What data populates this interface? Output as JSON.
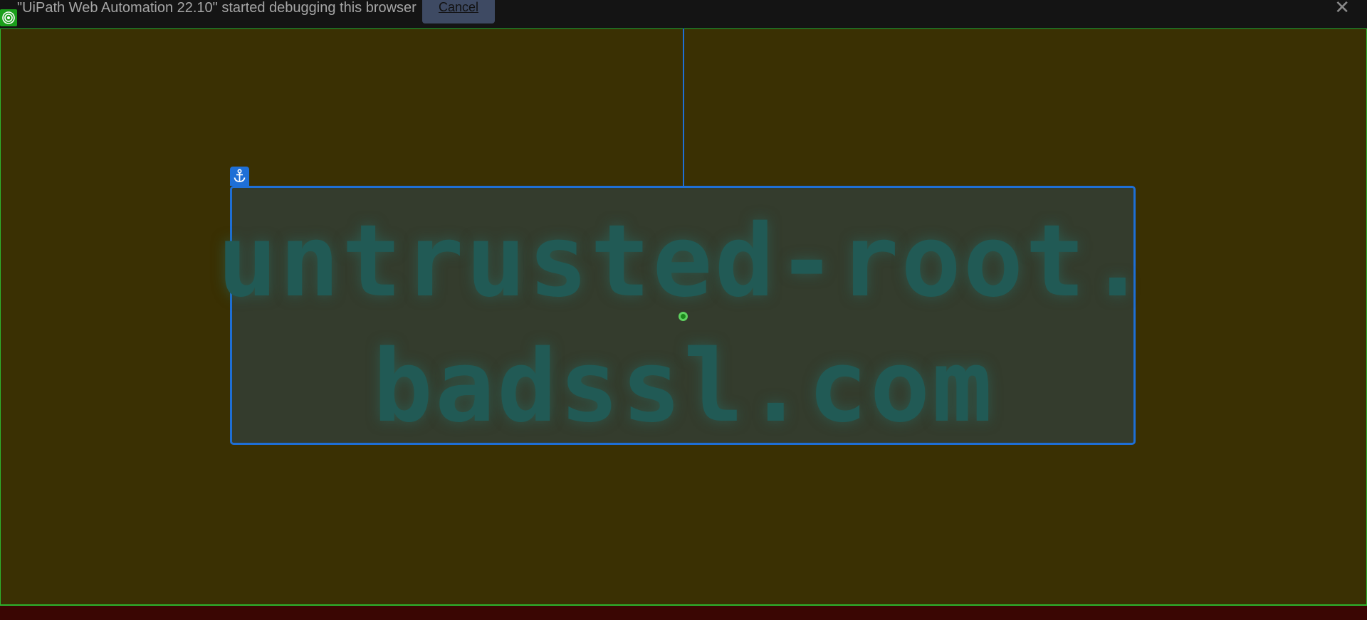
{
  "debug_bar": {
    "message": "\"UiPath Web Automation 22.10\" started debugging this browser",
    "cancel_label": "Cancel",
    "close_label": "✕"
  },
  "page": {
    "headline_line1": "untrusted-root.",
    "headline_line2": "badssl.com"
  },
  "icons": {
    "target": "target-icon",
    "anchor": "anchor-icon",
    "close": "close-icon"
  },
  "colors": {
    "page_background": "#3a3003",
    "selection_blue": "#1e6fd6",
    "frame_green": "#2db32d",
    "headline_teal": "#215a55"
  }
}
